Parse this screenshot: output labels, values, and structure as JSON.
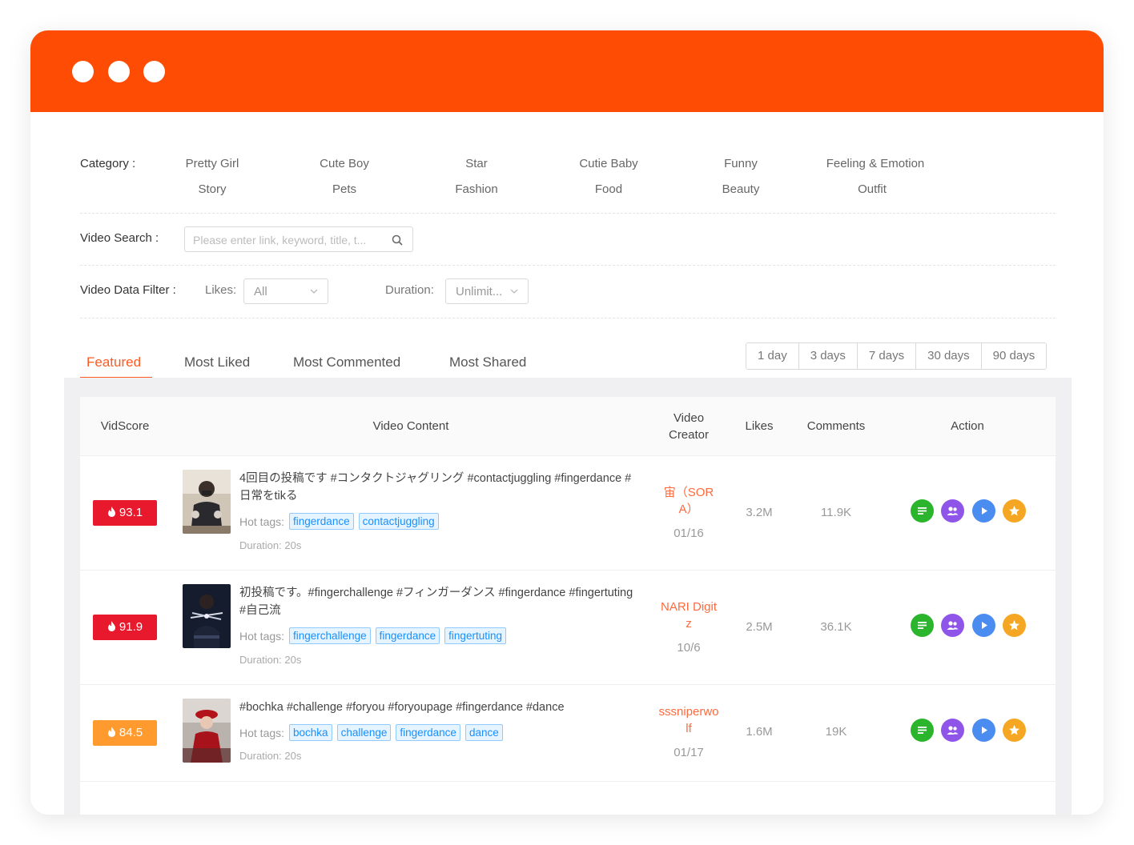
{
  "filters": {
    "category_label": "Category :",
    "categories": [
      "Pretty Girl",
      "Cute Boy",
      "Star",
      "Cutie Baby",
      "Funny",
      "Feeling & Emotion",
      "Story",
      "Pets",
      "Fashion",
      "Food",
      "Beauty",
      "Outfit"
    ],
    "search_label": "Video Search :",
    "search_placeholder": "Please enter link, keyword, title, t...",
    "data_filter_label": "Video Data Filter :",
    "likes_label": "Likes:",
    "likes_value": "All",
    "duration_label": "Duration:",
    "duration_value": "Unlimit..."
  },
  "tabs": [
    "Featured",
    "Most Liked",
    "Most Commented",
    "Most Shared"
  ],
  "active_tab": "Featured",
  "time_ranges": [
    "1 day",
    "3 days",
    "7 days",
    "30 days",
    "90 days"
  ],
  "table": {
    "headers": {
      "vidscore": "VidScore",
      "content": "Video Content",
      "creator_line1": "Video",
      "creator_line2": "Creator",
      "likes": "Likes",
      "comments": "Comments",
      "action": "Action"
    },
    "hot_tags_label": "Hot tags:",
    "rows": [
      {
        "score": "93.1",
        "score_color": "#e8192c",
        "title": "4回目の投稿です #コンタクトジャグリング #contactjuggling #fingerdance #日常をtikる",
        "tags": [
          "fingerdance",
          "contactjuggling"
        ],
        "duration": "Duration: 20s",
        "creator": "宙（SORA）",
        "date": "01/16",
        "likes": "3.2M",
        "comments": "11.9K"
      },
      {
        "score": "91.9",
        "score_color": "#e8192c",
        "title": "初投稿です。#fingerchallenge #フィンガーダンス #fingerdance #fingertuting #自己流",
        "tags": [
          "fingerchallenge",
          "fingerdance",
          "fingertuting"
        ],
        "duration": "Duration: 20s",
        "creator": "NARI Digitz",
        "date": "10/6",
        "likes": "2.5M",
        "comments": "36.1K"
      },
      {
        "score": "84.5",
        "score_color": "#ff9a2e",
        "title": "#bochka #challenge #foryou #foryoupage #fingerdance #dance",
        "tags": [
          "bochka",
          "challenge",
          "fingerdance",
          "dance"
        ],
        "duration": "Duration: 20s",
        "creator": "sssniperwolf",
        "date": "01/17",
        "likes": "1.6M",
        "comments": "19K"
      }
    ]
  },
  "colors": {
    "brand": "#ff4c04",
    "accent": "#ff5a1f",
    "score_high": "#e8192c",
    "score_mid": "#ff9a2e",
    "tag_blue": "#1890ff"
  },
  "icons": {
    "actions": [
      "list-icon",
      "users-icon",
      "play-icon",
      "star-icon"
    ]
  }
}
